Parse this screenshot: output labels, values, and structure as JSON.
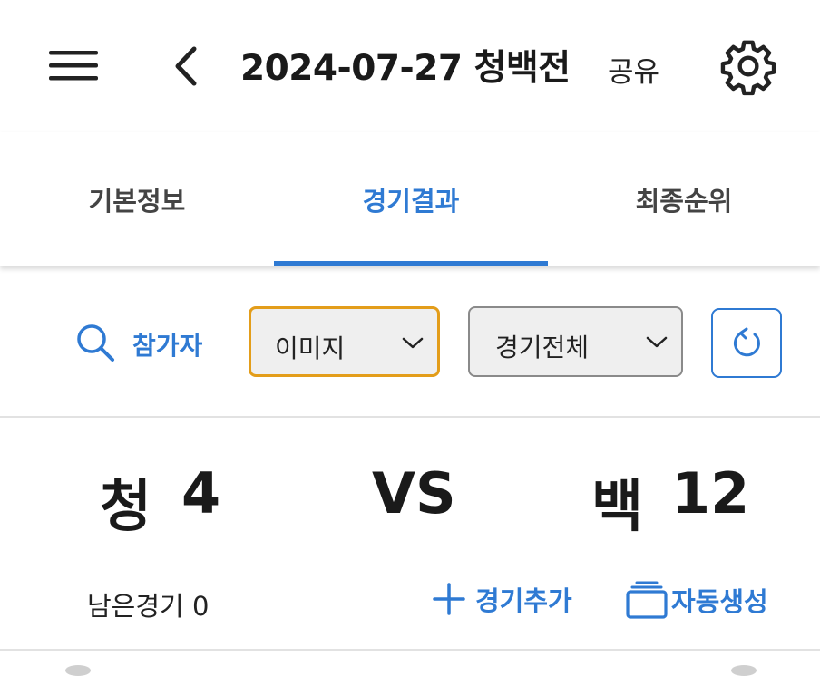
{
  "header": {
    "title": "2024-07-27 청백전",
    "share_label": "공유",
    "icons": [
      "menu-icon",
      "back-icon",
      "gear-icon"
    ]
  },
  "tabs": [
    {
      "label": "기본정보",
      "active": false
    },
    {
      "label": "경기결과",
      "active": true
    },
    {
      "label": "최종순위",
      "active": false
    }
  ],
  "filters": {
    "search_label": "참가자",
    "view_select": {
      "value": "이미지"
    },
    "match_select": {
      "value": "경기전체"
    }
  },
  "scoreboard": {
    "team1_name": "청",
    "team1_score": "4",
    "vs_label": "VS",
    "team2_name": "백",
    "team2_score": "12"
  },
  "actions": {
    "remaining_label": "남은경기 0",
    "add_game_label": "경기추가",
    "auto_generate_label": "자동생성"
  },
  "colors": {
    "accent": "#2f7ad3",
    "select_focus_border": "#e39d1a",
    "select_bg": "#efefef"
  }
}
